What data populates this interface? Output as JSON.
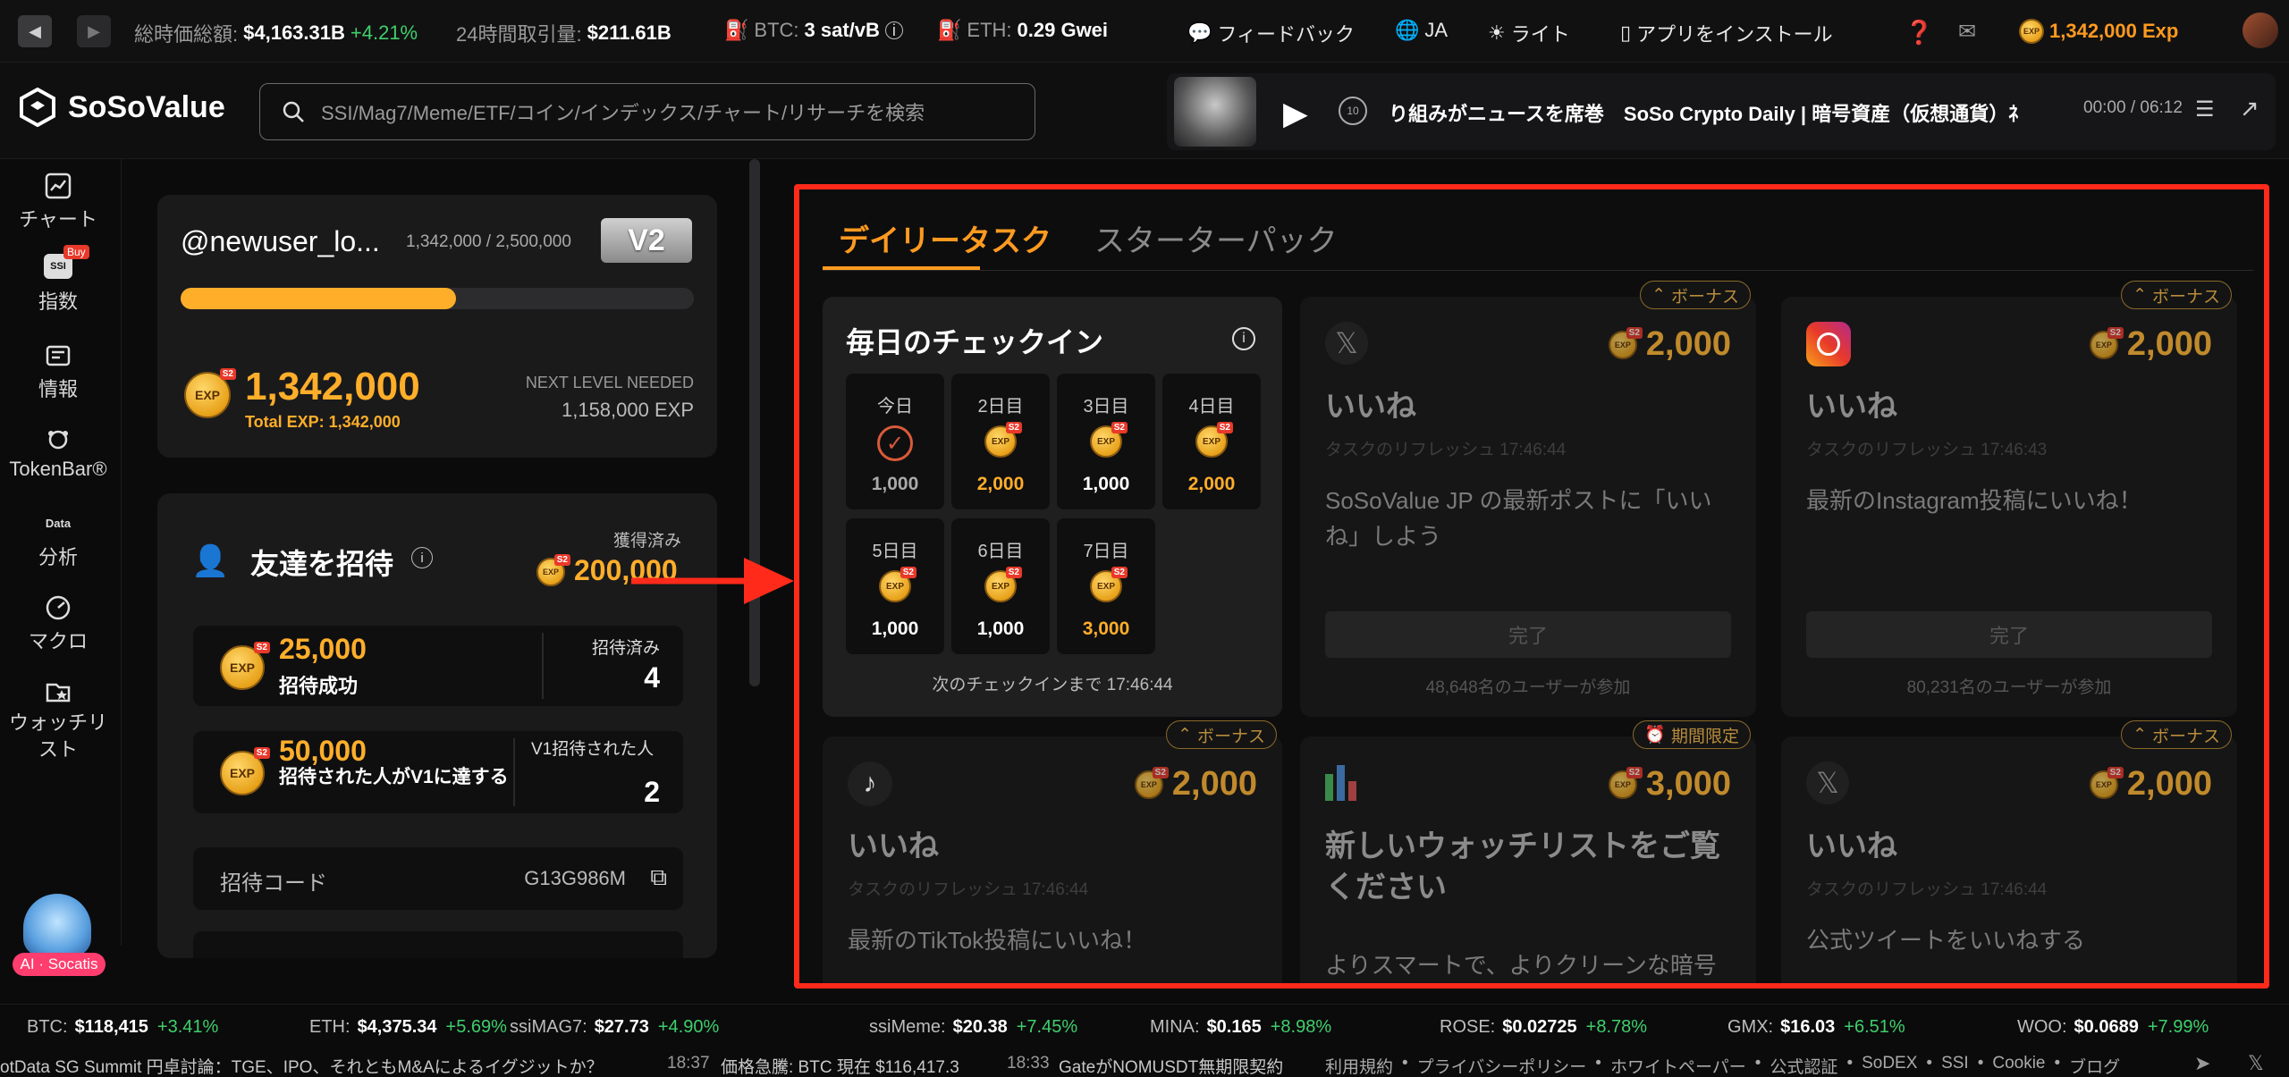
{
  "topbar": {
    "market_cap_label": "総時価総額:",
    "market_cap_value": "$4,163.31B",
    "market_cap_change": "+4.21%",
    "volume_label": "24時間取引量:",
    "volume_value": "$211.61B",
    "btc_label": "BTC:",
    "btc_fee": "3 sat/vB",
    "eth_label": "ETH:",
    "eth_fee": "0.29 Gwei",
    "feedback": "フィードバック",
    "language": "JA",
    "theme": "ライト",
    "install_app": "アプリをインストール",
    "exp_balance": "1,342,000 Exp"
  },
  "header": {
    "logo_text": "SoSoValue",
    "search_placeholder": "SSI/Mag7/Meme/ETF/コイン/インデックス/チャート/リサーチを検索",
    "player_title": "り組みがニュースを席巻　SoSo Crypto Daily | 暗号資産（仮想通貨）ﾈ",
    "player_time": "00:00 / 06:12"
  },
  "sidebar": {
    "items": [
      {
        "label": "チャート",
        "icon": "chart-icon"
      },
      {
        "label": "指数",
        "icon": "ssi-icon",
        "badge": "Buy",
        "icon_text": "SSI"
      },
      {
        "label": "情報",
        "icon": "news-icon"
      },
      {
        "label": "TokenBar®",
        "icon": "tokenbar-icon"
      },
      {
        "label": "分析",
        "icon": "data-icon",
        "icon_text": "Data"
      },
      {
        "label": "マクロ",
        "icon": "macro-icon"
      },
      {
        "label": "ウォッチリスト",
        "icon": "watchlist-icon"
      }
    ],
    "ai_label": "AI · Socatis"
  },
  "profile": {
    "username": "@newuser_lo...",
    "progress_text": "1,342,000 / 2,500,000",
    "level": "V2",
    "progress_fraction": 0.537,
    "exp_value": "1,342,000",
    "total_exp": "Total EXP: 1,342,000",
    "next_level_label": "NEXT LEVEL NEEDED",
    "next_level_value": "1,158,000 EXP"
  },
  "invite": {
    "title": "友達を招待",
    "earned_label": "獲得済み",
    "earned_value": "200,000",
    "row1_points": "25,000",
    "row1_desc": "招待成功",
    "row1_label": "招待済み",
    "row1_count": "4",
    "row2_points": "50,000",
    "row2_desc": "招待された人がV1に達する",
    "row2_label": "V1招待された人",
    "row2_count": "2",
    "code_label": "招待コード",
    "code_value": "G13G986M"
  },
  "tasks": {
    "tab_daily": "デイリータスク",
    "tab_starter": "スターターパック",
    "checkin_title": "毎日のチェックイン",
    "checkin_footer": "次のチェックインまで 17:46:44",
    "days": [
      {
        "label": "今日",
        "value": "1,000",
        "checked": true
      },
      {
        "label": "2日目",
        "value": "2,000",
        "accent": true
      },
      {
        "label": "3日目",
        "value": "1,000"
      },
      {
        "label": "4日目",
        "value": "2,000",
        "accent": true
      },
      {
        "label": "5日目",
        "value": "1,000"
      },
      {
        "label": "6日目",
        "value": "1,000"
      },
      {
        "label": "7日目",
        "value": "3,000",
        "accent": true
      }
    ],
    "cards": [
      {
        "badge": "ボーナス",
        "icon": "x-icon",
        "points": "2,000",
        "title": "いいね",
        "refresh": "タスクのリフレッシュ 17:46:44",
        "desc": "SoSoValue JP の最新ポストに「いいね」しよう",
        "button": "完了",
        "users": "48,648名のユーザーが参加"
      },
      {
        "badge": "ボーナス",
        "icon": "instagram-icon",
        "points": "2,000",
        "title": "いいね",
        "refresh": "タスクのリフレッシュ 17:46:43",
        "desc": "最新のInstagram投稿にいいね！",
        "button": "完了",
        "users": "80,231名のユーザーが参加"
      },
      {
        "badge": "ボーナス",
        "icon": "tiktok-icon",
        "points": "2,000",
        "title": "いいね",
        "refresh": "タスクのリフレッシュ 17:46:44",
        "desc": "最新のTikTok投稿にいいね！"
      },
      {
        "badge": "期間限定",
        "icon": "bar-chart-icon",
        "points": "3,000",
        "title": "新しいウォッチリストをご覧ください",
        "desc": "よりスマートで、よりクリーンな暗号"
      },
      {
        "badge": "ボーナス",
        "icon": "x-icon",
        "points": "2,000",
        "title": "いいね",
        "refresh": "タスクのリフレッシュ 17:46:44",
        "desc": "公式ツイートをいいねする"
      }
    ]
  },
  "ticker": [
    {
      "sym": "BTC:",
      "price": "$118,415",
      "chg": "+3.41%"
    },
    {
      "sym": "ETH:",
      "price": "$4,375.34",
      "chg": "+5.69%"
    },
    {
      "sym": "ssiMAG7:",
      "price": "$27.73",
      "chg": "+4.90%"
    },
    {
      "sym": "ssiMeme:",
      "price": "$20.38",
      "chg": "+7.45%"
    },
    {
      "sym": "MINA:",
      "price": "$0.165",
      "chg": "+8.98%"
    },
    {
      "sym": "ROSE:",
      "price": "$0.02725",
      "chg": "+8.78%"
    },
    {
      "sym": "GMX:",
      "price": "$16.03",
      "chg": "+6.51%"
    },
    {
      "sym": "WOO:",
      "price": "$0.0689",
      "chg": "+7.99%"
    }
  ],
  "footer": {
    "news1": "otData SG Summit 円卓討論：TGE、IPO、それともM&Aによるイグジットか？",
    "news2_time": "18:37",
    "news2": "価格急騰: BTC 現在 $116,417.3",
    "news3_time": "18:33",
    "news3": "GateがNOMUSDT無期限契約",
    "links": [
      "利用規約",
      "プライバシーポリシー",
      "ホワイトペーパー",
      "公式認証",
      "SoDEX",
      "SSI",
      "Cookie",
      "ブログ"
    ]
  },
  "colors": {
    "accent": "#ff9a1f",
    "positive": "#3fcf6b",
    "highlight": "#ff2a1a",
    "gold": "#c08a2c"
  }
}
